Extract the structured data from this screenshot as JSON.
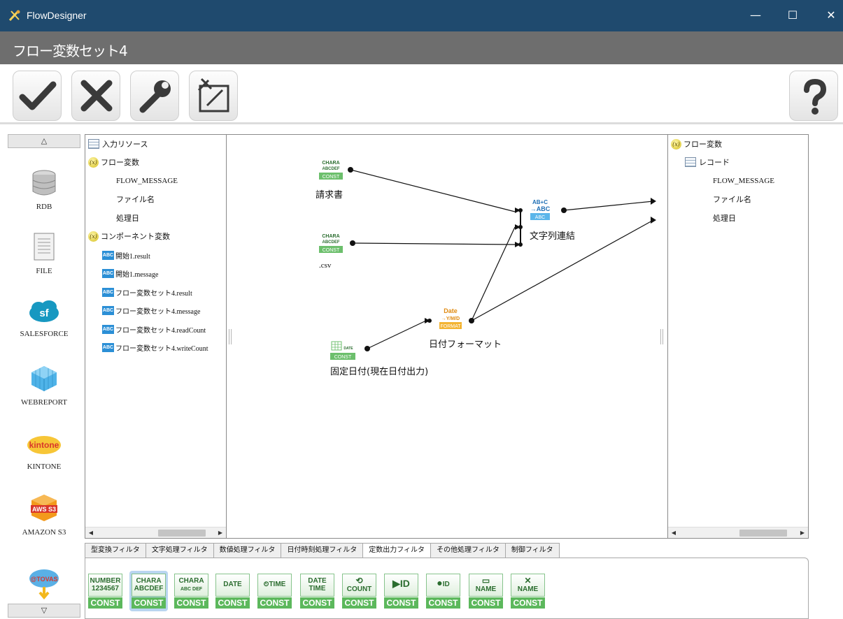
{
  "window": {
    "app_title": "FlowDesigner",
    "minimize": "—",
    "maximize": "☐",
    "close": "✕"
  },
  "header": {
    "title": "フロー変数セット4"
  },
  "toolbar": {
    "ok": "ok",
    "cancel": "cancel",
    "settings": "settings",
    "erase": "erase",
    "help": "help"
  },
  "left_panel": {
    "scroll_up": "△",
    "scroll_down": "▽",
    "connectors": [
      {
        "label": "RDB",
        "icon": "database-icon"
      },
      {
        "label": "FILE",
        "icon": "file-icon"
      },
      {
        "label": "SALESFORCE",
        "icon": "salesforce-icon",
        "logo_text": "sf"
      },
      {
        "label": "WEBREPORT",
        "icon": "webreport-icon"
      },
      {
        "label": "KINTONE",
        "icon": "kintone-icon",
        "logo_text": "kintone"
      },
      {
        "label": "AMAZON S3",
        "icon": "aws-s3-icon",
        "logo_text": "AWS S3"
      },
      {
        "label": "",
        "icon": "tovas-icon",
        "logo_text": "@TOVAS"
      }
    ]
  },
  "input_tree": {
    "root": "入力リソース",
    "flow_vars_label": "フロー変数",
    "flow_vars": [
      "FLOW_MESSAGE",
      "ファイル名",
      "処理日"
    ],
    "component_vars_label": "コンポーネント変数",
    "component_vars": [
      "開始1.result",
      "開始1.message",
      "フロー変数セット4.result",
      "フロー変数セット4.message",
      "フロー変数セット4.readCount",
      "フロー変数セット4.writeCount"
    ],
    "abc_icon": "ABC",
    "x_icon": "(x)"
  },
  "output_tree": {
    "root": "フロー変数",
    "record_label": "レコード",
    "items": [
      "FLOW_MESSAGE",
      "ファイル名",
      "処理日"
    ],
    "x_icon": "(x)"
  },
  "canvas": {
    "nodes": {
      "const1_label": "請求書",
      "const2_label": ".csv",
      "concat_label": "文字列連結",
      "datefmt_label": "日付フォーマット",
      "fixeddate_label": "固定日付(現在日付出力)"
    },
    "icon_text": {
      "chara": "CHARA",
      "abcdef": "ABCDEF",
      "const": "CONST",
      "abc_top": "AB+C",
      "abc_mid": "→ABC",
      "abc_bot": "ABC",
      "date": "Date",
      "date_mid": "→Y/M/D",
      "format": "FORMAT",
      "date_small": "DATE"
    }
  },
  "tabs": [
    {
      "label": "型変換フィルタ",
      "active": false
    },
    {
      "label": "文字処理フィルタ",
      "active": false
    },
    {
      "label": "数値処理フィルタ",
      "active": false
    },
    {
      "label": "日付時刻処理フィルタ",
      "active": false
    },
    {
      "label": "定数出力フィルタ",
      "active": true
    },
    {
      "label": "その他処理フィルタ",
      "active": false
    },
    {
      "label": "制御フィルタ",
      "active": false
    }
  ],
  "palette": [
    {
      "top": "NUMBER",
      "sub": "1234567",
      "const": "CONST",
      "icon": "number-const-icon"
    },
    {
      "top": "CHARA",
      "sub": "ABCDEF",
      "const": "CONST",
      "icon": "chara-const-icon"
    },
    {
      "top": "CHARA",
      "sub": "ABC DEF",
      "const": "CONST",
      "icon": "chara-split-const-icon"
    },
    {
      "top": "DATE",
      "sub": "",
      "const": "CONST",
      "icon": "date-const-icon"
    },
    {
      "top": "TIME",
      "sub": "",
      "const": "CONST",
      "icon": "time-const-icon"
    },
    {
      "top": "DATE",
      "sub": "TIME",
      "const": "CONST",
      "icon": "datetime-const-icon"
    },
    {
      "top": "COUNT",
      "sub": "",
      "const": "CONST",
      "icon": "count-const-icon"
    },
    {
      "top": "ID",
      "sub": "",
      "const": "CONST",
      "icon": "id-const-icon"
    },
    {
      "top": "ID",
      "sub": "",
      "const": "CONST",
      "icon": "user-id-const-icon"
    },
    {
      "top": "NAME",
      "sub": "",
      "const": "CONST",
      "icon": "name-const-icon"
    },
    {
      "top": "NAME",
      "sub": "",
      "const": "CONST",
      "icon": "sheet-name-const-icon"
    }
  ],
  "colors": {
    "titlebar": "#1f4a6e",
    "header": "#6e6e6e",
    "const_green": "#5cb85c",
    "abc_blue": "#2b8fd6",
    "date_orange": "#f0a21e"
  }
}
